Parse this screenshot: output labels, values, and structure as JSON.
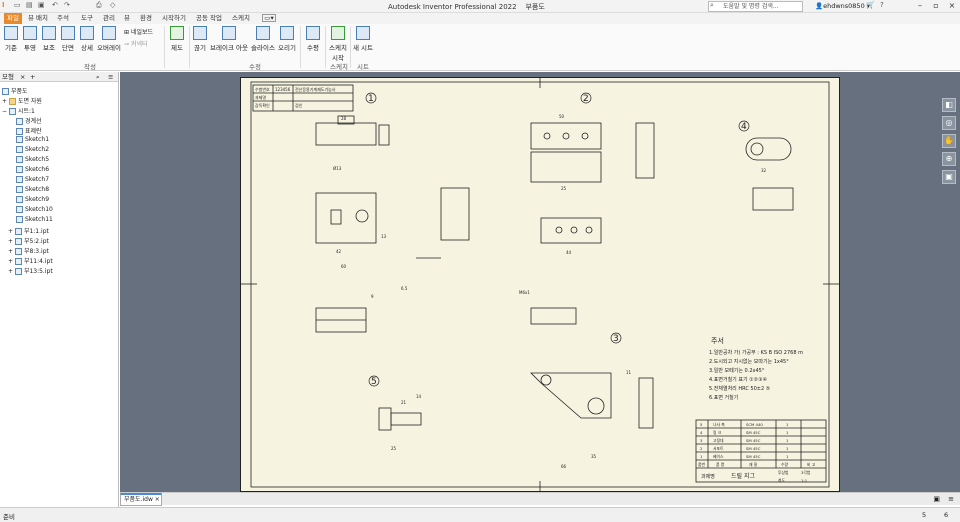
{
  "titlebar": {
    "app_title": "Autodesk Inventor Professional 2022",
    "doc_name": "부품도",
    "search_placeholder": "도움말 및 명령 검색...",
    "user": "ehdwns0850"
  },
  "tabs": [
    "파일",
    "뷰 배치",
    "주석",
    "도구",
    "관리",
    "뷰",
    "환경",
    "시작하기",
    "공동 작업",
    "스케치"
  ],
  "ribbon": {
    "buttons": [
      "기준",
      "투영",
      "보조",
      "단면",
      "상세",
      "오버레이",
      "제도",
      "끊기",
      "브레이크 아웃",
      "슬라이스",
      "오리기",
      "수평",
      "스케치 시작",
      "새 시트"
    ],
    "small": [
      "네일보드",
      "커넥터"
    ],
    "groups": [
      "작성",
      "수정",
      "스케치",
      "시트"
    ]
  },
  "browser": {
    "tab_label": "모형",
    "items": [
      "부품도",
      "도면 자원",
      "시트:1",
      "경계선",
      "표제란",
      "Sketch1",
      "Sketch2",
      "Sketch5",
      "Sketch6",
      "Sketch7",
      "Sketch8",
      "Sketch9",
      "Sketch10",
      "Sketch11",
      "부1:1.ipt",
      "부5:2.ipt",
      "부8:3.ipt",
      "부11:4.ipt",
      "부13:5.ipt"
    ]
  },
  "drawing": {
    "part_labels": [
      "1",
      "2",
      "3",
      "4",
      "5"
    ],
    "notes_title": "주서",
    "notes": [
      "1.일반공차 가) 가공부 : KS B ISO 2768 m",
      "2.도시되고 지시없는 모따기는 1x45°",
      "3.일반 모떼기는 0.2x45°",
      "4.표면거칠기 표기 ①②③④",
      "5.전체열처리 HRC 50±2 ⑤",
      "6.표면 거칠기"
    ],
    "parts_table": {
      "headers": [
        "품번",
        "품 명",
        "재 질",
        "수량",
        "비 고"
      ],
      "rows": [
        [
          "5",
          "나사 축",
          "SCM 440",
          "1",
          ""
        ],
        [
          "4",
          "링 크",
          "SM 45C",
          "1",
          ""
        ],
        [
          "3",
          "고정대",
          "SM 45C",
          "1",
          ""
        ],
        [
          "2",
          "서포트",
          "SM 45C",
          "1",
          ""
        ],
        [
          "1",
          "베이스",
          "SM 45C",
          "1",
          ""
        ]
      ]
    },
    "title_block": {
      "subject_label": "과제명",
      "subject": "드릴 지그",
      "scale_label": "척도",
      "scale": "1:1",
      "method_label": "투상법",
      "method": "3각법"
    },
    "header_table": [
      "수험번호",
      "123456",
      "전산응용기계제도기능사",
      "과제명",
      "감독확인",
      "검인"
    ],
    "dims": [
      "28",
      "42",
      "60",
      "13",
      "50",
      "25",
      "44",
      "66",
      "32",
      "6.5",
      "9",
      "11",
      "35",
      "21",
      "25",
      "14",
      "Ø13",
      "M6x1"
    ]
  },
  "status": {
    "left": "준비",
    "n1": "5",
    "n2": "6"
  },
  "doc_tab": "부품도.idw"
}
